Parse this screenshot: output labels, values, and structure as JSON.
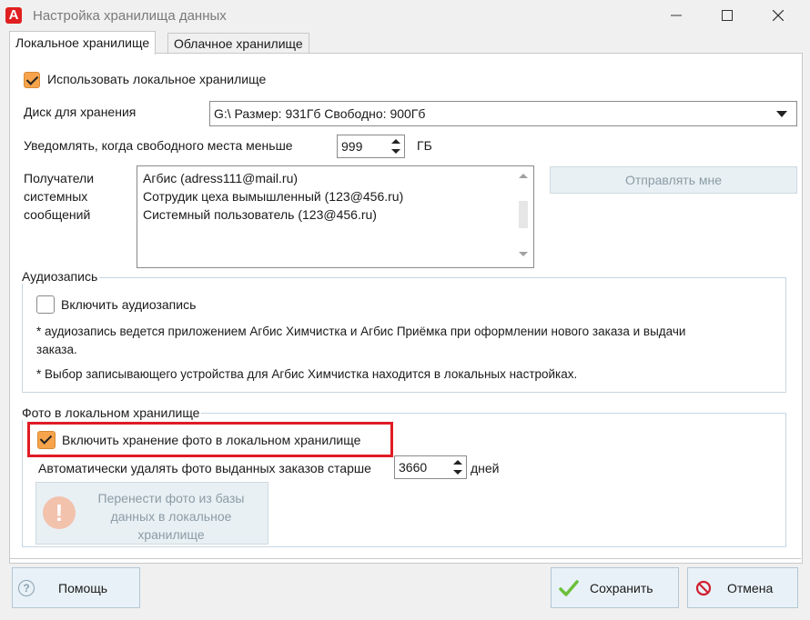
{
  "window": {
    "logo": "A",
    "title": "Настройка хранилища данных",
    "minimize_icon": "minimize-icon",
    "maximize_icon": "maximize-icon",
    "close_icon": "close-icon"
  },
  "tabs": [
    {
      "label": "Локальное хранилище",
      "active": true
    },
    {
      "label": "Облачное хранилище",
      "active": false
    }
  ],
  "local": {
    "use_local_label": "Использовать локальное хранилище",
    "use_local_checked": true,
    "disk_label": "Диск для хранения",
    "disk_value": "G:\\ Размер: 931Гб Свободно: 900Гб",
    "notify_label": "Уведомлять, когда свободного места меньше",
    "notify_value": "999",
    "notify_unit": "ГБ",
    "recipients_label_lines": [
      "Получатели",
      "системных",
      "сообщений"
    ],
    "recipients": [
      "Агбис (adress111@mail.ru)",
      "Сотрудик цеха вымышленный (123@456.ru)",
      "Системный пользователь (123@456.ru)"
    ],
    "send_me_label": "Отправлять мне"
  },
  "audio": {
    "group_title": "Аудиозапись",
    "enable_label": "Включить аудиозапись",
    "enable_checked": false,
    "note1_line1": "* аудиозапись ведется приложением Агбис Химчистка и Агбис Приёмка при оформлении нового заказа и выдачи",
    "note1_line2": "заказа.",
    "note2": "* Выбор записывающего устройства для Агбис Химчистка находится в локальных настройках."
  },
  "photo": {
    "group_title": "Фото в локальном хранилище",
    "enable_label": "Включить хранение фото в локальном хранилище",
    "enable_checked": true,
    "auto_delete_label": "Автоматически удалять фото выданных заказов старше",
    "auto_delete_value": "3660",
    "auto_delete_unit": "дней",
    "transfer_lines": [
      "Перенести фото из базы",
      "данных в локальное",
      "хранилище"
    ],
    "transfer_icon": "warning-icon"
  },
  "footer": {
    "help_label": "Помощь",
    "help_icon": "help-icon",
    "save_label": "Сохранить",
    "save_icon": "checkmark-icon",
    "cancel_label": "Отмена",
    "cancel_icon": "cancel-icon"
  },
  "colors": {
    "checkbox_checked": "#f6a34b",
    "highlight_border": "#e01b24",
    "logo_red": "#e02020",
    "save_green": "#6bbf3a"
  }
}
